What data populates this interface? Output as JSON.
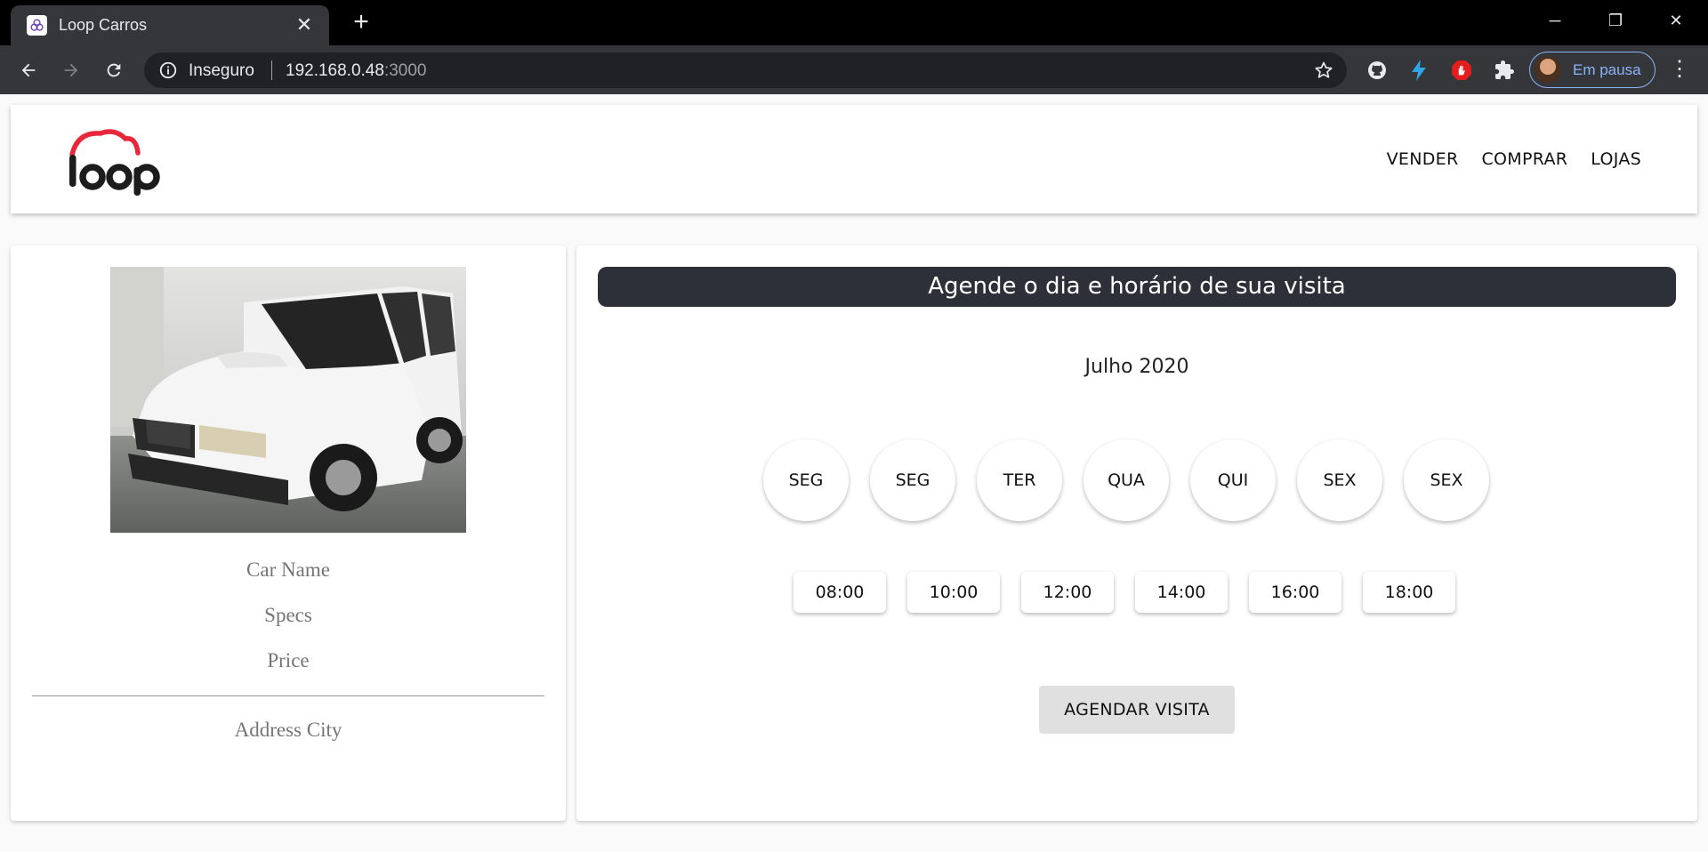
{
  "browser": {
    "tab_title": "Loop Carros",
    "tab_close": "✕",
    "new_tab": "+",
    "address": {
      "security_label": "Inseguro",
      "host": "192.168.0.48",
      "port": ":3000"
    },
    "profile_label": "Em pausa",
    "menu_glyph": "⋮",
    "window_controls": {
      "minimize": "─",
      "restore": "❐",
      "close": "✕"
    },
    "extensions": [
      "github-icon",
      "lightning-icon",
      "stop-hand-icon",
      "puzzle-icon"
    ]
  },
  "header": {
    "logo_text": "loop",
    "logo_color": "#e8283a",
    "nav": [
      {
        "label": "VENDER"
      },
      {
        "label": "COMPRAR"
      },
      {
        "label": "LOJAS"
      }
    ]
  },
  "car_card": {
    "name": "Car Name",
    "specs": "Specs",
    "price": "Price",
    "address": "Address City"
  },
  "schedule": {
    "banner": "Agende o dia e horário de sua visita",
    "month": "Julho 2020",
    "days": [
      "SEG",
      "SEG",
      "TER",
      "QUA",
      "QUI",
      "SEX",
      "SEX"
    ],
    "times": [
      "08:00",
      "10:00",
      "12:00",
      "14:00",
      "16:00",
      "18:00"
    ],
    "submit_label": "AGENDAR VISITA",
    "banner_color": "#2d3038"
  }
}
